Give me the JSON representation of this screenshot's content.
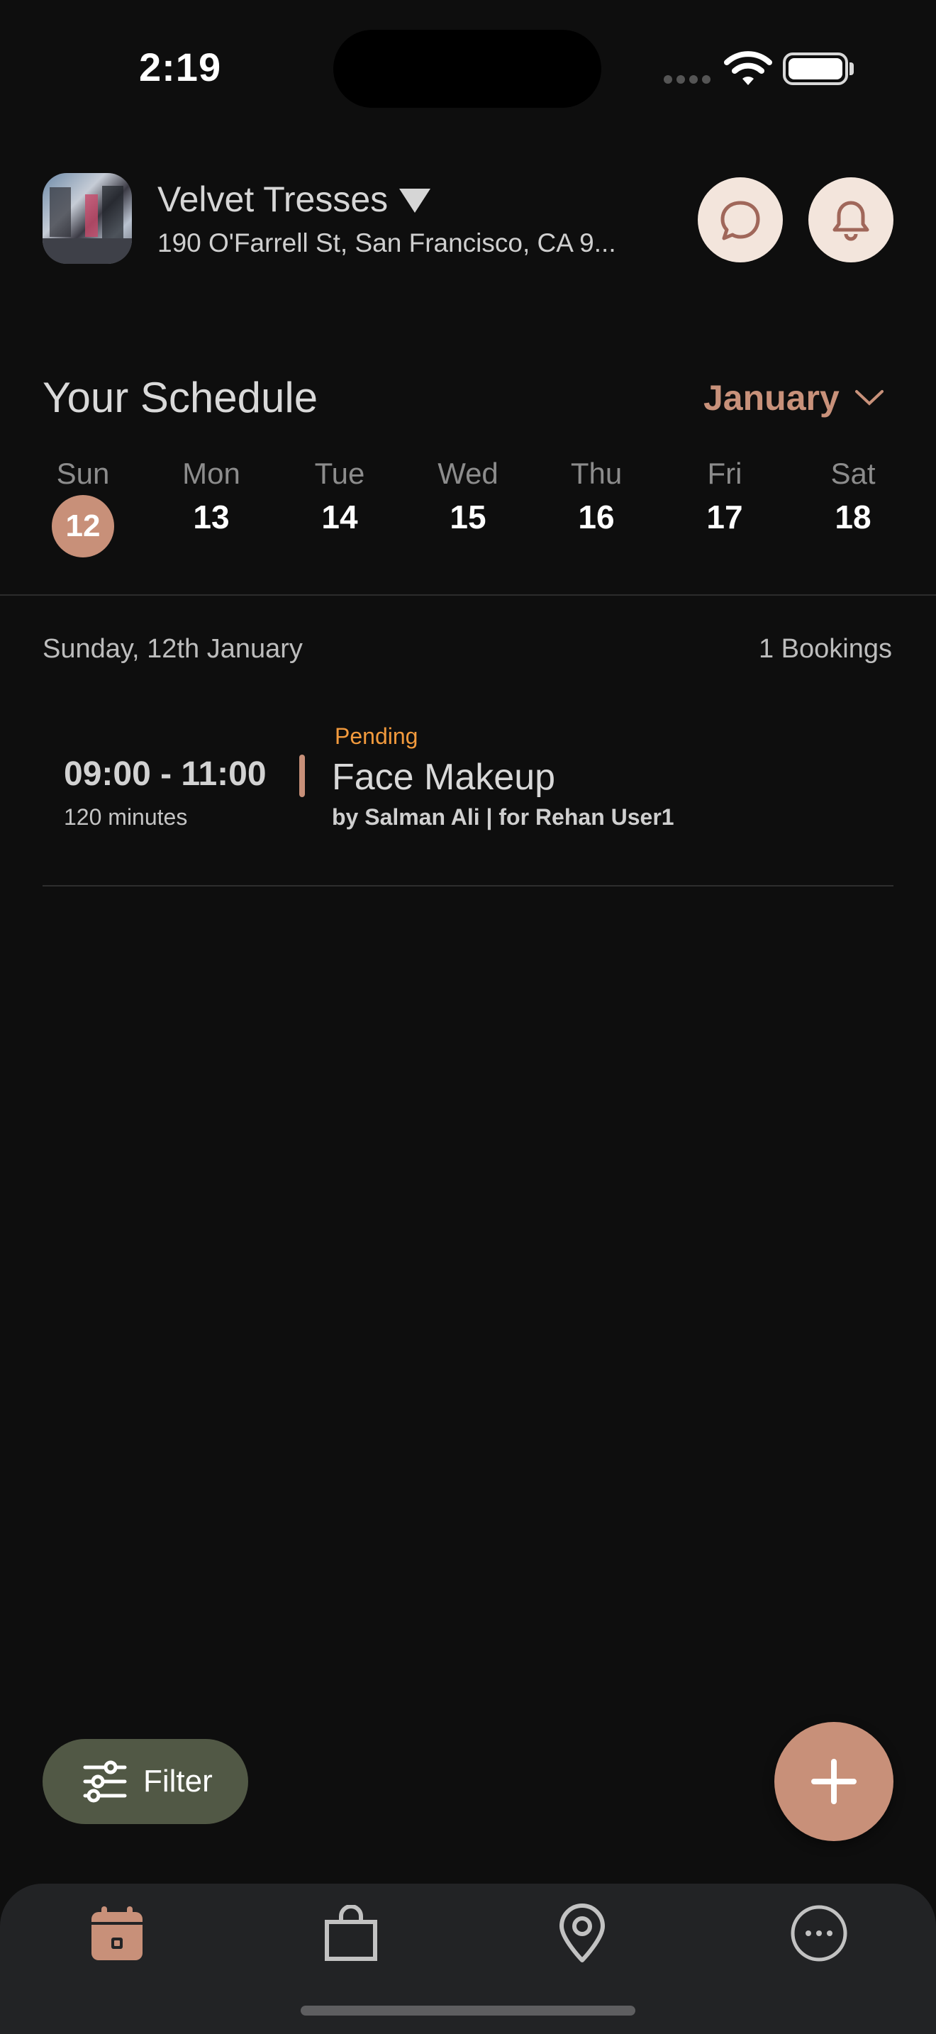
{
  "status_bar": {
    "time": "2:19"
  },
  "salon": {
    "name": "Velvet Tresses",
    "address": "190 O'Farrell St, San Francisco, CA 9..."
  },
  "header_actions": {
    "chat_icon": "chat-bubble-icon",
    "notification_icon": "bell-icon"
  },
  "schedule": {
    "title": "Your Schedule",
    "month": "January",
    "days": [
      {
        "name": "Sun",
        "num": "12",
        "selected": true
      },
      {
        "name": "Mon",
        "num": "13"
      },
      {
        "name": "Tue",
        "num": "14"
      },
      {
        "name": "Wed",
        "num": "15"
      },
      {
        "name": "Thu",
        "num": "16"
      },
      {
        "name": "Fri",
        "num": "17"
      },
      {
        "name": "Sat",
        "num": "18"
      }
    ],
    "date_heading": "Sunday, 12th January",
    "booking_count": "1 Bookings"
  },
  "bookings": [
    {
      "status": "Pending",
      "time": "09:00 - 11:00",
      "duration": "120 minutes",
      "service": "Face Makeup",
      "meta": "by Salman Ali | for Rehan  User1"
    }
  ],
  "filter": {
    "label": "Filter"
  },
  "tabbar": {
    "items": [
      {
        "icon": "calendar-icon",
        "active": true
      },
      {
        "icon": "shopping-bag-icon"
      },
      {
        "icon": "location-pin-icon"
      },
      {
        "icon": "more-icon"
      }
    ]
  },
  "colors": {
    "accent": "#c89079",
    "pending": "#f29a3d",
    "filter_bg": "#515845",
    "background": "#0e0e0e"
  }
}
